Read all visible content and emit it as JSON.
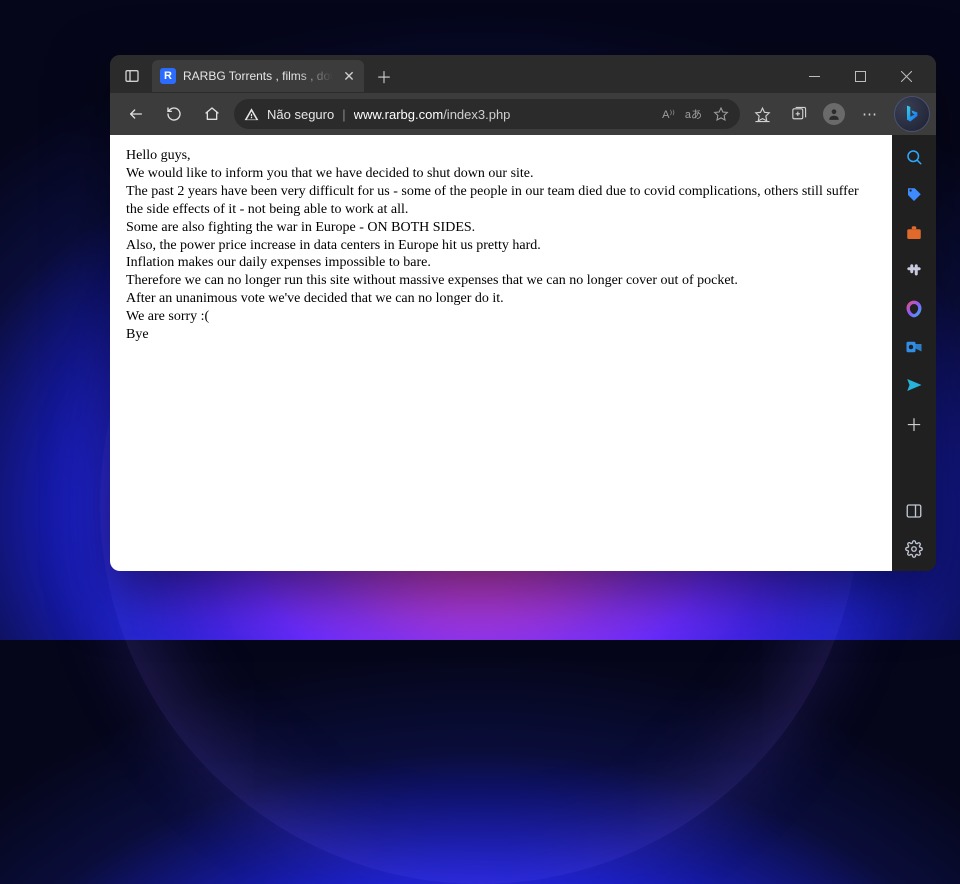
{
  "tab": {
    "title": "RARBG Torrents , films , downloa",
    "favicon_letter": "R"
  },
  "address_bar": {
    "security_label": "Não seguro",
    "url_host": "www.rarbg.com",
    "url_path": "/index3.php",
    "read_aloud_label": "A⁾⁾",
    "translate_label": "aあ"
  },
  "page": {
    "lines": [
      "Hello guys,",
      "We would like to inform you that we have decided to shut down our site.",
      "The past 2 years have been very difficult for us - some of the people in our team died due to covid complications, others still suffer the side effects of it - not being able to work at all.",
      "Some are also fighting the war in Europe - ON BOTH SIDES.",
      "Also, the power price increase in data centers in Europe hit us pretty hard.",
      "Inflation makes our daily expenses impossible to bare.",
      "Therefore we can no longer run this site without massive expenses that we can no longer cover out of pocket.",
      "After an unanimous vote we've decided that we can no longer do it.",
      "We are sorry :(",
      "Bye"
    ]
  }
}
